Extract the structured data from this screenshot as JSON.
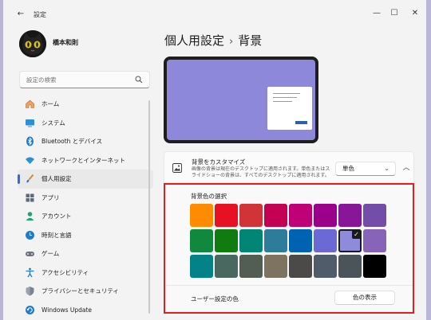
{
  "app": {
    "title": "設定",
    "back_icon": "back-arrow-icon"
  },
  "window_controls": {
    "minimize": "—",
    "maximize": "☐",
    "close": "✕"
  },
  "user": {
    "name": "橋本和則"
  },
  "search": {
    "placeholder": "設定の検索"
  },
  "nav": {
    "items": [
      {
        "label": "ホーム",
        "icon": "home-icon"
      },
      {
        "label": "システム",
        "icon": "display-icon"
      },
      {
        "label": "Bluetooth とデバイス",
        "icon": "bluetooth-icon"
      },
      {
        "label": "ネットワークとインターネット",
        "icon": "wifi-icon"
      },
      {
        "label": "個人用設定",
        "icon": "brush-icon",
        "active": true
      },
      {
        "label": "アプリ",
        "icon": "apps-icon"
      },
      {
        "label": "アカウント",
        "icon": "account-icon"
      },
      {
        "label": "時刻と言語",
        "icon": "clock-globe-icon"
      },
      {
        "label": "ゲーム",
        "icon": "gamepad-icon"
      },
      {
        "label": "アクセシビリティ",
        "icon": "accessibility-icon"
      },
      {
        "label": "プライバシーとセキュリティ",
        "icon": "shield-icon"
      },
      {
        "label": "Windows Update",
        "icon": "update-icon"
      }
    ]
  },
  "page": {
    "breadcrumb_parent": "個人用設定",
    "breadcrumb_sep": "›",
    "breadcrumb_current": "背景"
  },
  "customize": {
    "title": "背景をカスタマイズ",
    "description": "画像の背景は現在のデスクトップに適用されます。単色またはスライドショーの背景は、すべてのデスクトップに適用されます。",
    "dropdown_value": "単色",
    "dropdown_chevron": "⌄",
    "collapse_chevron": "︿"
  },
  "background_color": {
    "title": "背景色の選択",
    "rows": [
      [
        "#ff8c00",
        "#e81123",
        "#d13438",
        "#c30052",
        "#bf0077",
        "#9a0089",
        "#881798",
        "#744da9"
      ],
      [
        "#10893e",
        "#107c10",
        "#018574",
        "#2d7d9a",
        "#0063b1",
        "#6b69d6",
        "#8e8cd8",
        "#8764b8"
      ],
      [
        "#038387",
        "#486860",
        "#525e54",
        "#7e735f",
        "#4c4a48",
        "#515c6b",
        "#4a5459",
        "#000000"
      ]
    ],
    "selected": {
      "row": 1,
      "col": 6
    },
    "check_glyph": "✓",
    "custom_label": "ユーザー設定の色",
    "view_button": "色の表示"
  },
  "colors": {
    "accent": "#4a67b5",
    "highlight_border": "#e02020",
    "preview_bg": "#8d88da"
  }
}
